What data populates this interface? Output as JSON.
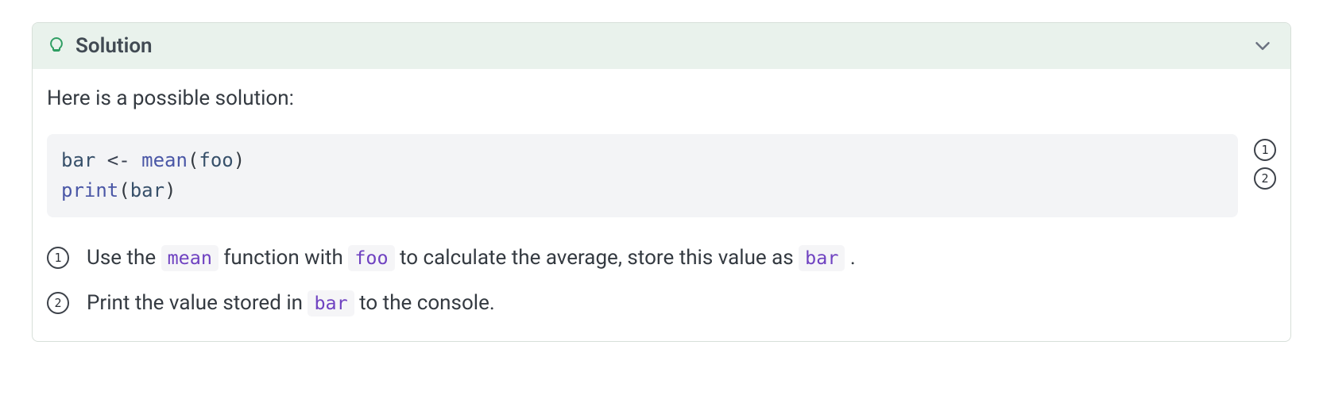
{
  "callout": {
    "title": "Solution",
    "intro": "Here is a possible solution:"
  },
  "code": {
    "line1": {
      "var": "bar",
      "assign": " <- ",
      "func": "mean",
      "lpar": "(",
      "arg": "foo",
      "rpar": ")"
    },
    "line2": {
      "func": "print",
      "lpar": "(",
      "arg": "bar",
      "rpar": ")"
    }
  },
  "annotations": {
    "badges": [
      "1",
      "2"
    ],
    "items": [
      {
        "num": "1",
        "parts": {
          "t0": "Use the ",
          "c0": "mean",
          "t1": " function with ",
          "c1": "foo",
          "t2": " to calculate the average, store this value as ",
          "c2": "bar",
          "t3": " ."
        }
      },
      {
        "num": "2",
        "parts": {
          "t0": "Print the value stored in ",
          "c0": "bar",
          "t1": " to the console."
        }
      }
    ]
  }
}
